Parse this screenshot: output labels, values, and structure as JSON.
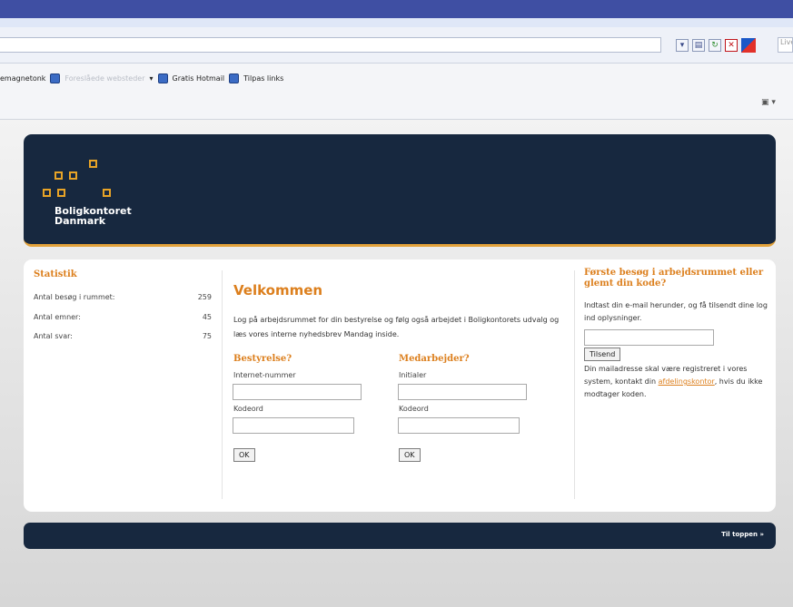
{
  "browser": {
    "links": [
      {
        "label": "emagnetonk"
      },
      {
        "label": "Foreslåede websteder",
        "faded": true
      },
      {
        "label": "Gratis Hotmail"
      },
      {
        "label": "Tilpas links"
      }
    ],
    "search_placeholder": "Live"
  },
  "site": {
    "logo_line1": "Boligkontoret",
    "logo_line2": "Danmark"
  },
  "stats": {
    "title": "Statistik",
    "rows": [
      {
        "label": "Antal besøg i rummet:",
        "value": "259"
      },
      {
        "label": "Antal emner:",
        "value": "45"
      },
      {
        "label": "Antal svar:",
        "value": "75"
      }
    ]
  },
  "main": {
    "title": "Velkommen",
    "intro": "Log på arbejdsrummet for din bestyrelse og følg også arbejdet i Boligkontorets udvalg og læs vores interne nyhedsbrev Mandag inside.",
    "board": {
      "title": "Bestyrelse?",
      "label1": "Internet-nummer",
      "label2": "Kodeord",
      "ok": "OK"
    },
    "staff": {
      "title": "Medarbejder?",
      "label1": "Initialer",
      "label2": "Kodeord",
      "ok": "OK"
    }
  },
  "sidebar": {
    "title": "Første besøg i arbejdsrummet eller glemt din kode?",
    "text1": "Indtast din e-mail herunder, og få tilsendt dine log ind oplysninger.",
    "send": "Tilsend",
    "text2_before": "Din mailadresse skal være registreret i vores system, kontakt din",
    "text2_link": "afdelingskontor",
    "text2_after": ", hvis du ikke modtager koden."
  },
  "footer": {
    "to_top": "Til toppen »"
  },
  "colors": {
    "navy": "#17283f",
    "orange": "#dc7f1d"
  }
}
